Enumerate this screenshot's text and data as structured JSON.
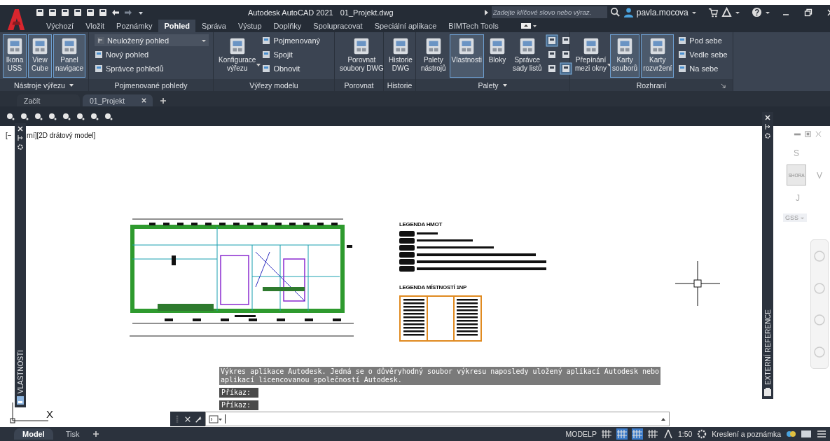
{
  "title_bar": {
    "title": "Autodesk AutoCAD 2021",
    "file": "01_Projekt.dwg",
    "search": {
      "placeholder": "Zadejte klíčové slovo nebo výraz."
    },
    "user": "pavla.mocova"
  },
  "menu_tabs": [
    {
      "label": "Výchozí",
      "selected": false
    },
    {
      "label": "Vložit",
      "selected": false
    },
    {
      "label": "Poznámky",
      "selected": false
    },
    {
      "label": "Pohled",
      "selected": true
    },
    {
      "label": "Správa",
      "selected": false
    },
    {
      "label": "Výstup",
      "selected": false
    },
    {
      "label": "Doplňky",
      "selected": false
    },
    {
      "label": "Spolupracovat",
      "selected": false
    },
    {
      "label": "Speciální aplikace",
      "selected": false
    },
    {
      "label": "BIMTech Tools",
      "selected": false
    }
  ],
  "ribbon": [
    {
      "title": "Nástroje výřezu",
      "has_menu": true,
      "launcher": false,
      "items": [
        {
          "kind": "large",
          "lines": [
            "Ikona",
            "USS"
          ],
          "selected": true,
          "has_menu": false
        },
        {
          "kind": "large",
          "lines": [
            "View",
            "Cube"
          ],
          "selected": true,
          "has_menu": false
        },
        {
          "kind": "large",
          "lines": [
            "Panel",
            "navigace"
          ],
          "selected": true,
          "has_menu": false
        }
      ]
    },
    {
      "title": "Pojmenované pohledy",
      "has_menu": false,
      "launcher": false,
      "items": [
        {
          "kind": "stack",
          "items": [
            {
              "kind": "dropdown",
              "label": "Neuložený pohled"
            },
            {
              "kind": "small",
              "label": "Nový pohled"
            },
            {
              "kind": "small",
              "label": "Správce pohledů"
            }
          ]
        }
      ]
    },
    {
      "title": "Výřezy modelu",
      "has_menu": false,
      "launcher": false,
      "items": [
        {
          "kind": "large",
          "lines": [
            "Konfigurace",
            "výřezu"
          ],
          "selected": false,
          "has_menu": true
        },
        {
          "kind": "stack",
          "items": [
            {
              "kind": "small",
              "label": "Pojmenovaný"
            },
            {
              "kind": "small",
              "label": "Spojit"
            },
            {
              "kind": "small",
              "label": "Obnovit"
            }
          ]
        }
      ]
    },
    {
      "title": "Porovnat",
      "has_menu": false,
      "launcher": false,
      "items": [
        {
          "kind": "large",
          "lines": [
            "Porovnat",
            "soubory DWG"
          ],
          "selected": false,
          "has_menu": false
        }
      ]
    },
    {
      "title": "Historie",
      "has_menu": false,
      "launcher": false,
      "items": [
        {
          "kind": "large",
          "lines": [
            "Historie",
            "DWG"
          ],
          "selected": false,
          "has_menu": false
        }
      ]
    },
    {
      "title": "Palety",
      "has_menu": true,
      "launcher": false,
      "items": [
        {
          "kind": "large",
          "lines": [
            "Palety",
            "nástrojů"
          ],
          "selected": false,
          "has_menu": false
        },
        {
          "kind": "large",
          "lines": [
            "Vlastnosti"
          ],
          "selected": true,
          "has_menu": false
        },
        {
          "kind": "large",
          "lines": [
            "Bloky"
          ],
          "selected": false,
          "has_menu": false
        },
        {
          "kind": "large",
          "lines": [
            "Správce",
            "sady listů"
          ],
          "selected": false,
          "has_menu": false
        },
        {
          "kind": "grid",
          "icons": [
            {
              "selected": true
            },
            {
              "selected": false
            },
            {
              "selected": false
            },
            {
              "selected": false
            },
            {
              "selected": false
            },
            {
              "selected": true
            }
          ]
        }
      ]
    },
    {
      "title": "Rozhraní",
      "has_menu": false,
      "launcher": true,
      "items": [
        {
          "kind": "large",
          "lines": [
            "Přepínání",
            "mezi okny"
          ],
          "selected": false,
          "has_menu": true
        },
        {
          "kind": "large",
          "lines": [
            "Karty",
            "souborů"
          ],
          "selected": true,
          "has_menu": false
        },
        {
          "kind": "large",
          "lines": [
            "Karty",
            "rozvržení"
          ],
          "selected": true,
          "has_menu": false
        },
        {
          "kind": "stack",
          "items": [
            {
              "kind": "small",
              "label": "Pod sebe"
            },
            {
              "kind": "small",
              "label": "Vedle sebe"
            },
            {
              "kind": "small",
              "label": "Na sebe"
            }
          ]
        }
      ]
    }
  ],
  "file_tabs": [
    {
      "label": "Začít",
      "selected": false
    },
    {
      "label": "01_Projekt",
      "selected": true
    }
  ],
  "viewport": {
    "label_start": "[−",
    "label_end": "rní][2D drátový model]"
  },
  "palettes": {
    "left": "VLASTNOSTI",
    "right": "EXTERNÍ REFERENCE"
  },
  "legend": {
    "mass_title": "LEGENDA HMOT",
    "rooms_title": "LEGENDA MÍSTNOSTÍ 1NP"
  },
  "viewcube": {
    "north": "S",
    "east": "V",
    "south": "J",
    "face": "SHORA",
    "ucs": "GSS"
  },
  "ucs_icon": {
    "x_label": "X"
  },
  "command_history": [
    {
      "kind": "message",
      "lines": [
        "Výkres aplikace Autodesk. Jedná se o důvěryhodný soubor výkresu naposledy uložený aplikací Autodesk nebo",
        "aplikací licencovanou společností Autodesk."
      ]
    },
    {
      "kind": "prompt",
      "lines": [
        "Příkaz:"
      ]
    },
    {
      "kind": "prompt",
      "lines": [
        "Příkaz:"
      ]
    }
  ],
  "layout_tabs": [
    {
      "label": "Model",
      "selected": true
    },
    {
      "label": "Tisk",
      "selected": false
    }
  ],
  "status_bar": {
    "space": "MODELP",
    "toggles": [
      {
        "on": false
      },
      {
        "on": true
      },
      {
        "on": true
      },
      {
        "on": false
      }
    ],
    "scale": "1:50",
    "workspace": "Kreslení a poznámka"
  }
}
